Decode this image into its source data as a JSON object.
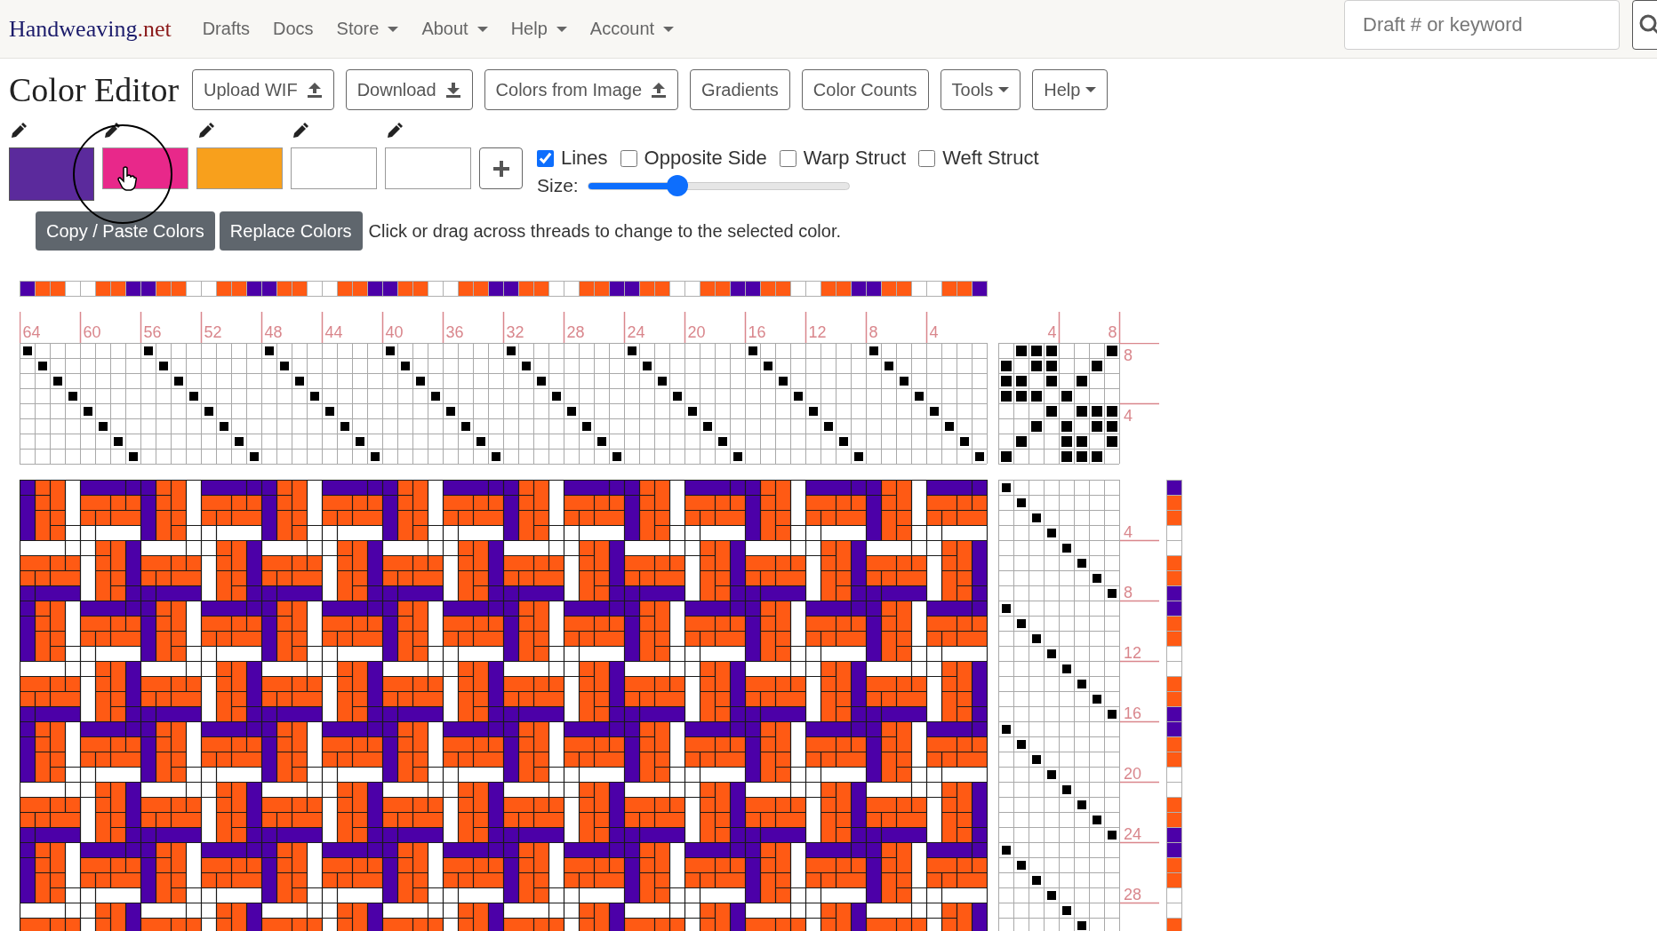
{
  "nav": {
    "brand": {
      "name": "Handweaving",
      "suffix": ".net"
    },
    "links": [
      {
        "label": "Drafts",
        "dropdown": false
      },
      {
        "label": "Docs",
        "dropdown": false
      },
      {
        "label": "Store",
        "dropdown": true
      },
      {
        "label": "About",
        "dropdown": true
      },
      {
        "label": "Help",
        "dropdown": true
      },
      {
        "label": "Account",
        "dropdown": true
      }
    ],
    "search": {
      "placeholder": "Draft # or keyword"
    }
  },
  "title": "Color Editor",
  "toolbar": [
    {
      "label": "Upload WIF",
      "kind": "upload",
      "dropdown": false
    },
    {
      "label": "Download",
      "kind": "download",
      "dropdown": false
    },
    {
      "label": "Colors from Image",
      "kind": "upload",
      "dropdown": false
    },
    {
      "label": "Gradients",
      "kind": "plain",
      "dropdown": false
    },
    {
      "label": "Color Counts",
      "kind": "plain",
      "dropdown": false
    },
    {
      "label": "Tools",
      "kind": "plain",
      "dropdown": true
    },
    {
      "label": "Help",
      "kind": "plain",
      "dropdown": true
    }
  ],
  "palette": [
    {
      "color": "#5b2a9c",
      "selected": true
    },
    {
      "color": "#e8288a",
      "selected": false
    },
    {
      "color": "#f8a01c",
      "selected": false
    },
    {
      "color": "#ffffff",
      "selected": false
    },
    {
      "color": "#ffffff",
      "selected": false
    }
  ],
  "options": [
    {
      "label": "Lines",
      "checked": true
    },
    {
      "label": "Opposite Side",
      "checked": false
    },
    {
      "label": "Warp Struct",
      "checked": false
    },
    {
      "label": "Weft Struct",
      "checked": false
    }
  ],
  "size": {
    "label": "Size:",
    "level": 0.33
  },
  "actions": [
    "Copy / Paste Colors",
    "Replace Colors"
  ],
  "hint": "Click or drag across threads to change to the selected color.",
  "draft": {
    "warp": [
      {
        "color": "#4c00a8",
        "kind": "shaft8"
      },
      {
        "color": "#ff5a14",
        "kind": "shaft7"
      },
      {
        "color": "#ff5a14",
        "kind": "shaft6"
      },
      {
        "color": "#ffffff",
        "kind": "shaft5"
      },
      {
        "color": "#ffffff",
        "kind": "shaft4"
      },
      {
        "color": "#ff5a14",
        "kind": "shaft3"
      },
      {
        "color": "#ff5a14",
        "kind": "shaft2"
      },
      {
        "color": "#4c00a8",
        "kind": "shaft1"
      },
      {
        "color": "#4c00a8",
        "kind": "shaft8"
      },
      {
        "color": "#ff5a14",
        "kind": "shaft7"
      },
      {
        "color": "#ff5a14",
        "kind": "shaft6"
      },
      {
        "color": "#ffffff",
        "kind": "shaft5"
      },
      {
        "color": "#ffffff",
        "kind": "shaft4"
      },
      {
        "color": "#ff5a14",
        "kind": "shaft3"
      },
      {
        "color": "#ff5a14",
        "kind": "shaft2"
      },
      {
        "color": "#4c00a8",
        "kind": "shaft1"
      },
      {
        "color": "#4c00a8",
        "kind": "shaft8"
      },
      {
        "color": "#ff5a14",
        "kind": "shaft7"
      },
      {
        "color": "#ff5a14",
        "kind": "shaft6"
      },
      {
        "color": "#ffffff",
        "kind": "shaft5"
      },
      {
        "color": "#ffffff",
        "kind": "shaft4"
      },
      {
        "color": "#ff5a14",
        "kind": "shaft3"
      },
      {
        "color": "#ff5a14",
        "kind": "shaft2"
      },
      {
        "color": "#4c00a8",
        "kind": "shaft1"
      },
      {
        "color": "#4c00a8",
        "kind": "shaft8"
      },
      {
        "color": "#ff5a14",
        "kind": "shaft7"
      },
      {
        "color": "#ff5a14",
        "kind": "shaft6"
      },
      {
        "color": "#ffffff",
        "kind": "shaft5"
      },
      {
        "color": "#ffffff",
        "kind": "shaft4"
      },
      {
        "color": "#ff5a14",
        "kind": "shaft3"
      },
      {
        "color": "#ff5a14",
        "kind": "shaft2"
      },
      {
        "color": "#4c00a8",
        "kind": "shaft1"
      },
      {
        "color": "#4c00a8",
        "kind": "shaft8"
      },
      {
        "color": "#ff5a14",
        "kind": "shaft7"
      },
      {
        "color": "#ff5a14",
        "kind": "shaft6"
      },
      {
        "color": "#ffffff",
        "kind": "shaft5"
      },
      {
        "color": "#ffffff",
        "kind": "shaft4"
      },
      {
        "color": "#ff5a14",
        "kind": "shaft3"
      },
      {
        "color": "#ff5a14",
        "kind": "shaft2"
      },
      {
        "color": "#4c00a8",
        "kind": "shaft1"
      },
      {
        "color": "#4c00a8",
        "kind": "shaft8"
      },
      {
        "color": "#ff5a14",
        "kind": "shaft7"
      },
      {
        "color": "#ff5a14",
        "kind": "shaft6"
      },
      {
        "color": "#ffffff",
        "kind": "shaft5"
      },
      {
        "color": "#ffffff",
        "kind": "shaft4"
      },
      {
        "color": "#ff5a14",
        "kind": "shaft3"
      },
      {
        "color": "#ff5a14",
        "kind": "shaft2"
      },
      {
        "color": "#4c00a8",
        "kind": "shaft1"
      },
      {
        "color": "#4c00a8",
        "kind": "shaft8"
      },
      {
        "color": "#ff5a14",
        "kind": "shaft7"
      },
      {
        "color": "#ff5a14",
        "kind": "shaft6"
      },
      {
        "color": "#ffffff",
        "kind": "shaft5"
      },
      {
        "color": "#ffffff",
        "kind": "shaft4"
      },
      {
        "color": "#ff5a14",
        "kind": "shaft3"
      },
      {
        "color": "#ff5a14",
        "kind": "shaft2"
      },
      {
        "color": "#4c00a8",
        "kind": "shaft1"
      },
      {
        "color": "#4c00a8",
        "kind": "shaft8"
      },
      {
        "color": "#ff5a14",
        "kind": "shaft7"
      },
      {
        "color": "#ff5a14",
        "kind": "shaft6"
      },
      {
        "color": "#ffffff",
        "kind": "shaft5"
      },
      {
        "color": "#ffffff",
        "kind": "shaft4"
      },
      {
        "color": "#ff5a14",
        "kind": "shaft3"
      },
      {
        "color": "#ff5a14",
        "kind": "shaft2"
      },
      {
        "color": "#4c00a8",
        "kind": "shaft1"
      }
    ],
    "thread_numbers": [
      "64",
      "60",
      "56",
      "52",
      "48",
      "44",
      "40",
      "36",
      "32",
      "28",
      "24",
      "20",
      "16",
      "12",
      "8",
      "4"
    ],
    "tieup_top_numbers": [
      "4",
      "8"
    ],
    "tieup_side_numbers": [
      "8",
      "4"
    ],
    "tieup": [
      {
        "kind": "oxxxooox"
      },
      {
        "kind": "xoxxooxo"
      },
      {
        "kind": "xxoxoxoo"
      },
      {
        "kind": "xxxoxooo"
      },
      {
        "kind": "oooxoxxx"
      },
      {
        "kind": "ooxoxoxx"
      },
      {
        "kind": "oxooxxox"
      },
      {
        "kind": "xoooxxxo"
      }
    ],
    "treadle_numbers": [
      "4",
      "8",
      "12",
      "16",
      "20",
      "24",
      "28"
    ],
    "weft": [
      {
        "color": "#4c00a8",
        "kind": "treadle1"
      },
      {
        "color": "#ff5a14",
        "kind": "treadle2"
      },
      {
        "color": "#ff5a14",
        "kind": "treadle3"
      },
      {
        "color": "#ffffff",
        "kind": "treadle4"
      },
      {
        "color": "#ffffff",
        "kind": "treadle5"
      },
      {
        "color": "#ff5a14",
        "kind": "treadle6"
      },
      {
        "color": "#ff5a14",
        "kind": "treadle7"
      },
      {
        "color": "#4c00a8",
        "kind": "treadle8"
      },
      {
        "color": "#4c00a8",
        "kind": "treadle1"
      },
      {
        "color": "#ff5a14",
        "kind": "treadle2"
      },
      {
        "color": "#ff5a14",
        "kind": "treadle3"
      },
      {
        "color": "#ffffff",
        "kind": "treadle4"
      },
      {
        "color": "#ffffff",
        "kind": "treadle5"
      },
      {
        "color": "#ff5a14",
        "kind": "treadle6"
      },
      {
        "color": "#ff5a14",
        "kind": "treadle7"
      },
      {
        "color": "#4c00a8",
        "kind": "treadle8"
      },
      {
        "color": "#4c00a8",
        "kind": "treadle1"
      },
      {
        "color": "#ff5a14",
        "kind": "treadle2"
      },
      {
        "color": "#ff5a14",
        "kind": "treadle3"
      },
      {
        "color": "#ffffff",
        "kind": "treadle4"
      },
      {
        "color": "#ffffff",
        "kind": "treadle5"
      },
      {
        "color": "#ff5a14",
        "kind": "treadle6"
      },
      {
        "color": "#ff5a14",
        "kind": "treadle7"
      },
      {
        "color": "#4c00a8",
        "kind": "treadle8"
      },
      {
        "color": "#4c00a8",
        "kind": "treadle1"
      },
      {
        "color": "#ff5a14",
        "kind": "treadle2"
      },
      {
        "color": "#ff5a14",
        "kind": "treadle3"
      },
      {
        "color": "#ffffff",
        "kind": "treadle4"
      },
      {
        "color": "#ffffff",
        "kind": "treadle5"
      },
      {
        "color": "#ff5a14",
        "kind": "treadle6"
      }
    ]
  }
}
